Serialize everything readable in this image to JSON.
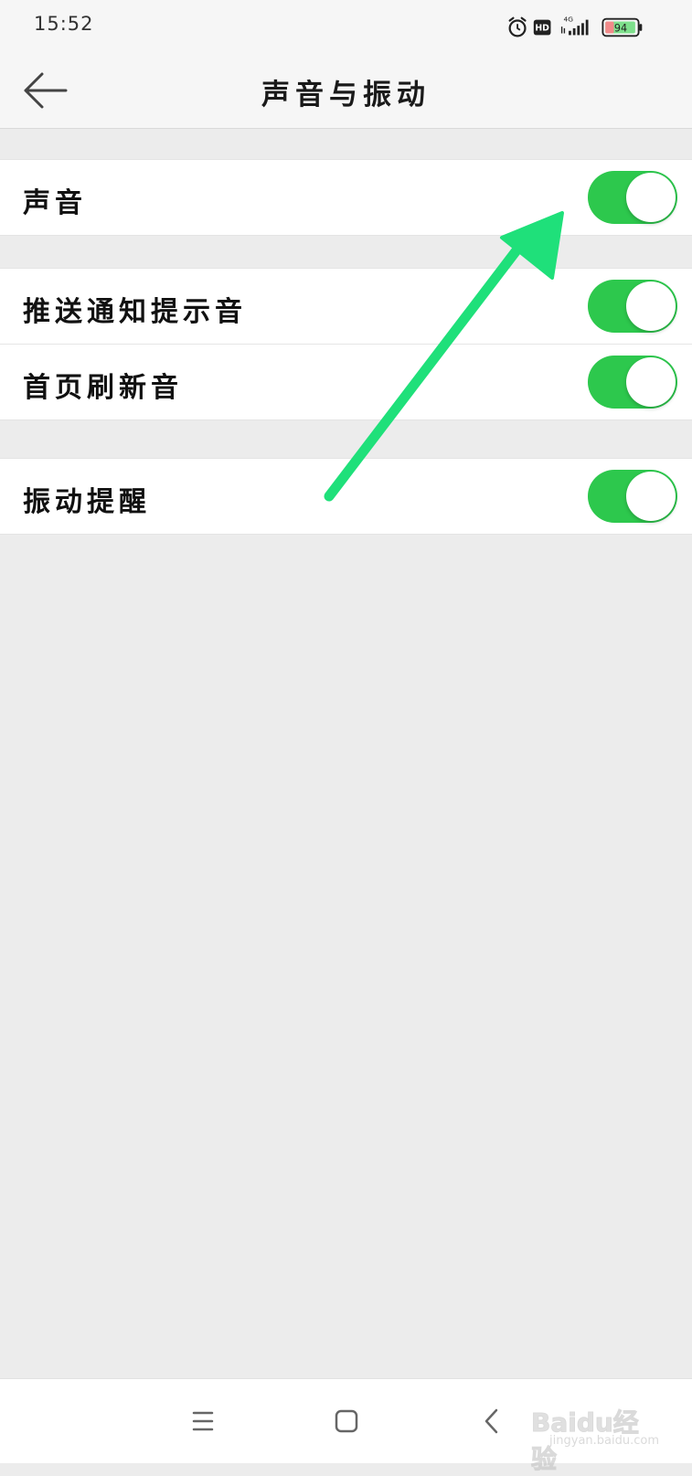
{
  "status_bar": {
    "time": "15:52",
    "network_label": "4G",
    "hd_label": "HD",
    "battery_level": "94",
    "icons": [
      "alarm-icon",
      "hd-icon",
      "signal-icon",
      "battery-icon"
    ]
  },
  "header": {
    "title": "声音与振动",
    "back_icon": "back-arrow-icon"
  },
  "groups": [
    {
      "items": [
        {
          "label": "声音",
          "enabled": true
        }
      ]
    },
    {
      "items": [
        {
          "label": "推送通知提示音",
          "enabled": true
        },
        {
          "label": "首页刷新音",
          "enabled": true
        }
      ]
    },
    {
      "items": [
        {
          "label": "振动提醒",
          "enabled": true
        }
      ]
    }
  ],
  "nav_bar": {
    "buttons": [
      "menu-icon",
      "home-icon",
      "back-icon"
    ],
    "watermark_text": "Baidu经验",
    "watermark_sub": "jingyan.baidu.com"
  },
  "colors": {
    "toggle_on": "#2dc84d",
    "annotation_arrow": "#1fe07a",
    "background": "#ececec"
  }
}
